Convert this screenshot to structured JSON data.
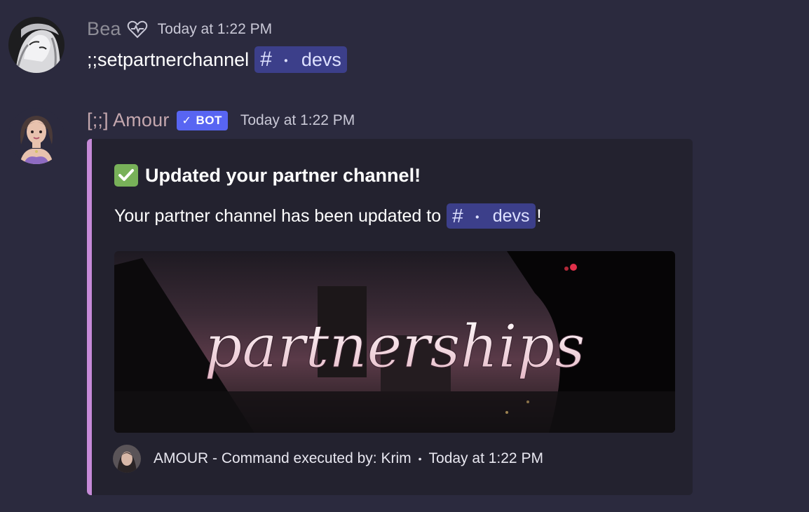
{
  "messages": [
    {
      "username": "Bea",
      "username_color": "#8d8c96",
      "timestamp": "Today at 1:22 PM",
      "status_icon": "heart-pulse-icon",
      "content_text": ";;setpartnerchannel",
      "channel_mention": {
        "hash": "#",
        "dot": "・",
        "name": "devs"
      }
    },
    {
      "username": "[;;] Amour",
      "username_color": "#c4a7ae",
      "badge": {
        "check": "✓",
        "label": "BOT"
      },
      "timestamp": "Today at 1:22 PM",
      "embed": {
        "accent_color": "#c68ad8",
        "title_icon": "white-check-mark-icon",
        "title": "Updated your partner channel!",
        "description_prefix": "Your partner channel has been updated to",
        "description_mention": {
          "hash": "#",
          "dot": "・",
          "name": "devs"
        },
        "description_suffix": "!",
        "image_text": "partnerships",
        "footer": {
          "text": "AMOUR - Command executed by: Krim",
          "separator": "•",
          "timestamp": "Today at 1:22 PM"
        }
      }
    }
  ]
}
